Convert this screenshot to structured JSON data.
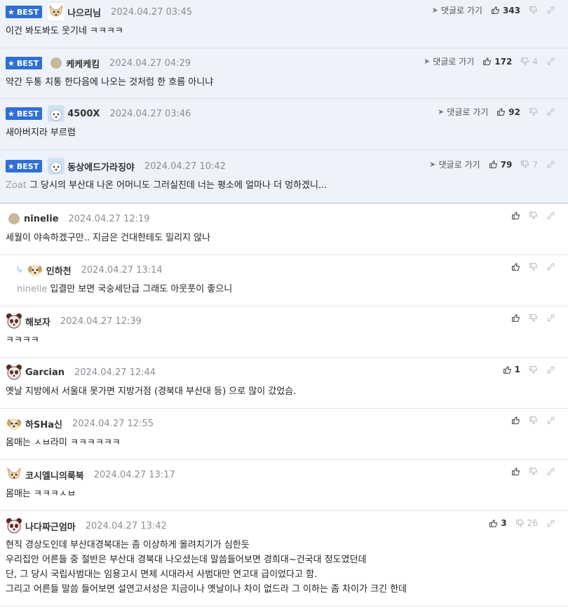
{
  "labels": {
    "best": "BEST",
    "goto_reply": "댓글로 가기"
  },
  "best_comments": [
    {
      "nick": "나으리님",
      "date": "2024.04.27 03:45",
      "up": "343",
      "down": "",
      "text": "이건 봐도봐도 웃기네 ㅋㅋㅋㅋ",
      "reply_to": "",
      "avatar": "dog-avatar"
    },
    {
      "nick": "케케케킴",
      "date": "2024.04.27 04:29",
      "up": "172",
      "down": "4",
      "text": "약간 두통 치통 한다음에 나오는 것처럼 한 흐름 아니냐",
      "reply_to": "",
      "avatar": "round-avatar"
    },
    {
      "nick": "4500X",
      "date": "2024.04.27 03:46",
      "up": "92",
      "down": "",
      "text": "새아버지라 부르렴",
      "reply_to": "",
      "avatar": "polar-avatar"
    },
    {
      "nick": "동상에드가라징야",
      "date": "2024.04.27 10:42",
      "up": "79",
      "down": "7",
      "text": "그 당시의 부산대 나온 어머니도 그러실진데 너는 평소에 얼마나 더 멍하겠니...",
      "reply_to": "Zoat",
      "avatar": "polar-avatar"
    }
  ],
  "comments": [
    {
      "nick": "ninelie",
      "date": "2024.04.27 12:19",
      "up": "",
      "down": "",
      "text": "세월이 야속하겠구만.. 지금은 건대한테도 밀리지 않나",
      "reply_to": "",
      "avatar": "round-avatar",
      "is_reply": false
    },
    {
      "nick": "인하천",
      "date": "2024.04.27 13:14",
      "up": "",
      "down": "",
      "text": "입결만 보면 국숭세단급 그래도 아웃풋이 좋으니",
      "reply_to": "ninelie",
      "avatar": "puppy-avatar",
      "is_reply": true
    },
    {
      "nick": "해보자",
      "date": "2024.04.27 12:39",
      "up": "",
      "down": "",
      "text": "ㅋㅋㅋㅋ",
      "reply_to": "",
      "avatar": "panda-avatar",
      "is_reply": false
    },
    {
      "nick": "Garcian",
      "date": "2024.04.27 12:44",
      "up": "1",
      "down": "",
      "text": "옛날 지방에서 서울대 못가면 지방거점 (경북대 부산대 등) 으로 많이 갔었슴.",
      "reply_to": "",
      "avatar": "panda-avatar",
      "is_reply": false
    },
    {
      "nick": "하SHa신",
      "date": "2024.04.27 12:55",
      "up": "",
      "down": "",
      "text": "몸매는 ㅅㅂ라미 ㅋㅋㅋㅋㅋㅋ",
      "reply_to": "",
      "avatar": "puppy-avatar",
      "is_reply": false
    },
    {
      "nick": "코시엘니의룩북",
      "date": "2024.04.27 13:17",
      "up": "",
      "down": "",
      "text": "몸매는 ㅋㅋㅋㅅㅂ",
      "reply_to": "",
      "avatar": "dog-avatar",
      "is_reply": false
    },
    {
      "nick": "나다짜근엄마",
      "date": "2024.04.27 13:42",
      "up": "3",
      "down": "26",
      "text_lines": [
        "현직 경상도인데 부산대경북대는 좀 이상하게 올려치기가 심한듯",
        "우리집안 어른들 중 절반은 부산대 경북대 나오셨는데 말씀들어보면 경희대~건국대 정도였던데",
        "단, 그 당시 국립사범대는 임용고시 면제 시대라서 사범대만 연고대 급이었다고 함.",
        "그리고 어른들 말씀 들어보면 설연고서성은 지금이나 옛날이나 차이 없드라 그 이하는 좀 차이가 크긴 한데"
      ],
      "reply_to": "",
      "avatar": "panda-avatar",
      "is_reply": false
    }
  ]
}
